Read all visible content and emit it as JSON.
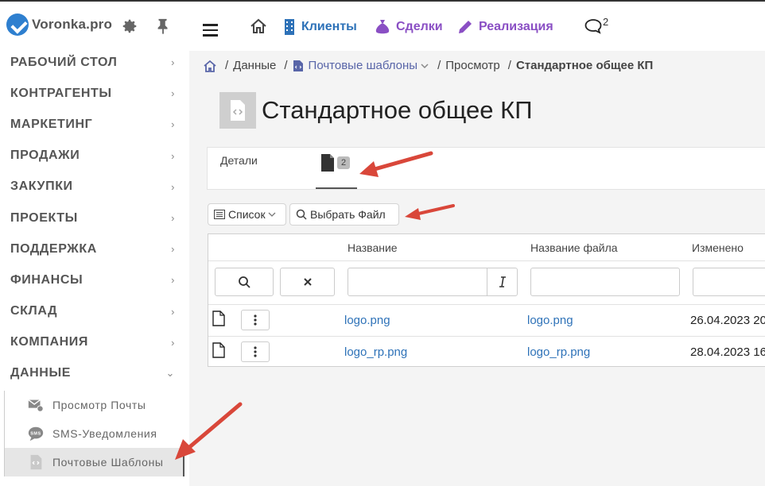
{
  "brand": {
    "name": "Voronka.pro"
  },
  "sidebar": {
    "items": [
      {
        "label": "РАБОЧИЙ СТОЛ",
        "chev": "›"
      },
      {
        "label": "КОНТРАГЕНТЫ",
        "chev": "›"
      },
      {
        "label": "МАРКЕТИНГ",
        "chev": "›"
      },
      {
        "label": "ПРОДАЖИ",
        "chev": "›"
      },
      {
        "label": "ЗАКУПКИ",
        "chev": "›"
      },
      {
        "label": "ПРОЕКТЫ",
        "chev": "›"
      },
      {
        "label": "ПОДДЕРЖКА",
        "chev": "›"
      },
      {
        "label": "ФИНАНСЫ",
        "chev": "›"
      },
      {
        "label": "СКЛАД",
        "chev": "›"
      },
      {
        "label": "КОМПАНИЯ",
        "chev": "›"
      },
      {
        "label": "ДАННЫЕ",
        "chev": "⌄"
      }
    ],
    "subitems": [
      {
        "label": "Просмотр Почты",
        "icon": "mail-view-icon"
      },
      {
        "label": "SMS-Уведомления",
        "icon": "sms-icon"
      },
      {
        "label": "Почтовые Шаблоны",
        "icon": "code-file-icon",
        "active": true
      }
    ]
  },
  "topnav": {
    "clients": "Клиенты",
    "deals": "Сделки",
    "realization": "Реализация",
    "chat_count": "2",
    "colors": {
      "clients": "#2e72b8",
      "deals": "#8a4fc4",
      "realization": "#8a4fc4"
    }
  },
  "breadcrumb": {
    "data": "Данные",
    "templates": "Почтовые шаблоны",
    "view": "Просмотр",
    "current": "Стандартное общее КП"
  },
  "page": {
    "title": "Стандартное общее КП"
  },
  "tabs": {
    "details": "Детали",
    "files_count": "2"
  },
  "toolbar": {
    "list": "Список",
    "choose_file": "Выбрать Файл"
  },
  "table": {
    "headers": {
      "name": "Название",
      "file_name": "Название файла",
      "modified": "Изменено"
    },
    "rows": [
      {
        "name": "logo.png",
        "file_name": "logo.png",
        "modified": "26.04.2023 20"
      },
      {
        "name": "logo_rp.png",
        "file_name": "logo_rp.png",
        "modified": "28.04.2023 16"
      }
    ]
  },
  "annotation_color": "#d9473a"
}
